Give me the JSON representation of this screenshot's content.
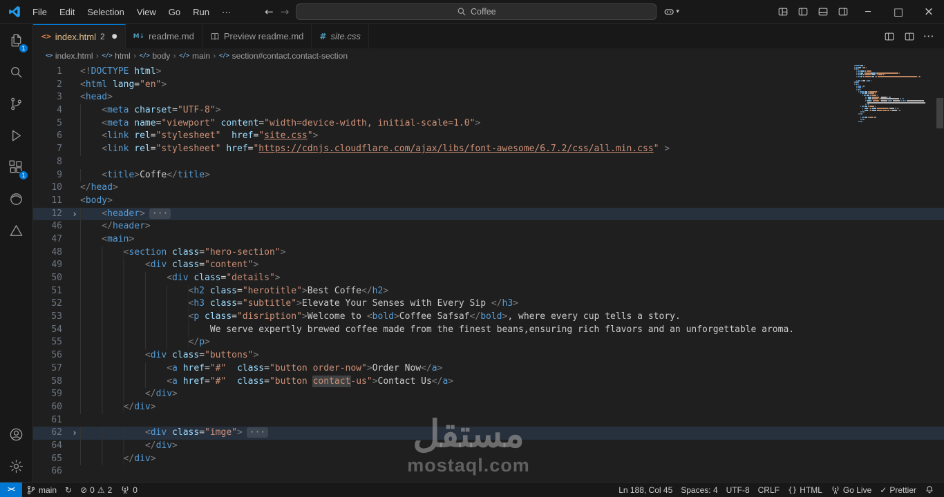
{
  "titlebar": {
    "menus": [
      "File",
      "Edit",
      "Selection",
      "View",
      "Go",
      "Run",
      "···"
    ],
    "search_text": "Coffee"
  },
  "icons": {
    "back": "←",
    "forward": "→",
    "chevron_down": "▾",
    "minimize": "─",
    "maximize": "□",
    "close": "×",
    "html_file": "<>",
    "markdown_file": "M↓",
    "css_file": "#",
    "element": "</>",
    "dirty": "●",
    "tab_more": "···",
    "fold": "›",
    "crumb_sep": "›",
    "remote": "><",
    "sync": "↻",
    "error": "⊘",
    "warning": "⚠",
    "check": "✓",
    "braces": "{}"
  },
  "activity_bar": {
    "explorer_badge": "1",
    "extensions_badge": "1"
  },
  "tabs": [
    {
      "label": "index.html",
      "badge": "2"
    },
    {
      "label": "readme.md"
    },
    {
      "label": "Preview readme.md"
    },
    {
      "label": "site.css"
    }
  ],
  "breadcrumb": [
    "index.html",
    "html",
    "body",
    "main",
    "section#contact.contact-section"
  ],
  "editor": {
    "lines": [
      {
        "n": 1,
        "i": 0,
        "t": [
          [
            "p",
            "<!"
          ],
          [
            "t",
            "DOCTYPE"
          ],
          [
            "a",
            " html"
          ],
          [
            "p",
            ">"
          ]
        ]
      },
      {
        "n": 2,
        "i": 0,
        "t": [
          [
            "p",
            "<"
          ],
          [
            "t",
            "html"
          ],
          [
            "a",
            " lang"
          ],
          [
            "o",
            "="
          ],
          [
            "s",
            "\"en\""
          ],
          [
            "p",
            ">"
          ]
        ]
      },
      {
        "n": 3,
        "i": 0,
        "t": [
          [
            "p",
            "<"
          ],
          [
            "t",
            "head"
          ],
          [
            "p",
            ">"
          ]
        ]
      },
      {
        "n": 4,
        "i": 4,
        "t": [
          [
            "p",
            "<"
          ],
          [
            "t",
            "meta"
          ],
          [
            "a",
            " charset"
          ],
          [
            "o",
            "="
          ],
          [
            "s",
            "\"UTF-8\""
          ],
          [
            "p",
            ">"
          ]
        ]
      },
      {
        "n": 5,
        "i": 4,
        "t": [
          [
            "p",
            "<"
          ],
          [
            "t",
            "meta"
          ],
          [
            "a",
            " name"
          ],
          [
            "o",
            "="
          ],
          [
            "s",
            "\"viewport\""
          ],
          [
            "a",
            " content"
          ],
          [
            "o",
            "="
          ],
          [
            "s",
            "\"width=device-width, initial-scale=1.0\""
          ],
          [
            "p",
            ">"
          ]
        ]
      },
      {
        "n": 6,
        "i": 4,
        "t": [
          [
            "p",
            "<"
          ],
          [
            "t",
            "link"
          ],
          [
            "a",
            " rel"
          ],
          [
            "o",
            "="
          ],
          [
            "s",
            "\"stylesheet\""
          ],
          [
            "a",
            "  href"
          ],
          [
            "o",
            "="
          ],
          [
            "s",
            "\""
          ],
          [
            "u",
            "site.css"
          ],
          [
            "s",
            "\""
          ],
          [
            "p",
            ">"
          ]
        ]
      },
      {
        "n": 7,
        "i": 4,
        "t": [
          [
            "p",
            "<"
          ],
          [
            "t",
            "link"
          ],
          [
            "a",
            " rel"
          ],
          [
            "o",
            "="
          ],
          [
            "s",
            "\"stylesheet\""
          ],
          [
            "a",
            " href"
          ],
          [
            "o",
            "="
          ],
          [
            "s",
            "\""
          ],
          [
            "u",
            "https://cdnjs.cloudflare.com/ajax/libs/font-awesome/6.7.2/css/all.min.css"
          ],
          [
            "s",
            "\""
          ],
          [
            "o",
            " "
          ],
          [
            "p",
            ">"
          ]
        ]
      },
      {
        "n": 8,
        "i": 0,
        "t": []
      },
      {
        "n": 9,
        "i": 4,
        "t": [
          [
            "p",
            "<"
          ],
          [
            "t",
            "title"
          ],
          [
            "p",
            ">"
          ],
          [
            "x",
            "Coffe"
          ],
          [
            "p",
            "</"
          ],
          [
            "t",
            "title"
          ],
          [
            "p",
            ">"
          ]
        ]
      },
      {
        "n": 10,
        "i": 0,
        "t": [
          [
            "p",
            "</"
          ],
          [
            "t",
            "head"
          ],
          [
            "p",
            ">"
          ]
        ]
      },
      {
        "n": 11,
        "i": 0,
        "t": [
          [
            "p",
            "<"
          ],
          [
            "t",
            "body"
          ],
          [
            "p",
            ">"
          ]
        ]
      },
      {
        "n": 12,
        "i": 4,
        "fold": true,
        "hl": true,
        "t": [
          [
            "p",
            "<"
          ],
          [
            "t",
            "header"
          ],
          [
            "p",
            ">"
          ],
          [
            "f",
            "···"
          ]
        ]
      },
      {
        "n": 46,
        "i": 4,
        "t": [
          [
            "p",
            "</"
          ],
          [
            "t",
            "header"
          ],
          [
            "p",
            ">"
          ]
        ]
      },
      {
        "n": 47,
        "i": 4,
        "t": [
          [
            "p",
            "<"
          ],
          [
            "t",
            "main"
          ],
          [
            "p",
            ">"
          ]
        ]
      },
      {
        "n": 48,
        "i": 8,
        "t": [
          [
            "p",
            "<"
          ],
          [
            "t",
            "section"
          ],
          [
            "a",
            " class"
          ],
          [
            "o",
            "="
          ],
          [
            "s",
            "\"hero-section\""
          ],
          [
            "p",
            ">"
          ]
        ]
      },
      {
        "n": 49,
        "i": 12,
        "t": [
          [
            "p",
            "<"
          ],
          [
            "t",
            "div"
          ],
          [
            "a",
            " class"
          ],
          [
            "o",
            "="
          ],
          [
            "s",
            "\"content\""
          ],
          [
            "p",
            ">"
          ]
        ]
      },
      {
        "n": 50,
        "i": 16,
        "t": [
          [
            "p",
            "<"
          ],
          [
            "t",
            "div"
          ],
          [
            "a",
            " class"
          ],
          [
            "o",
            "="
          ],
          [
            "s",
            "\"details\""
          ],
          [
            "p",
            ">"
          ]
        ]
      },
      {
        "n": 51,
        "i": 20,
        "t": [
          [
            "p",
            "<"
          ],
          [
            "t",
            "h2"
          ],
          [
            "a",
            " class"
          ],
          [
            "o",
            "="
          ],
          [
            "s",
            "\"herotitle\""
          ],
          [
            "p",
            ">"
          ],
          [
            "x",
            "Best Coffe"
          ],
          [
            "p",
            "</"
          ],
          [
            "t",
            "h2"
          ],
          [
            "p",
            ">"
          ]
        ]
      },
      {
        "n": 52,
        "i": 20,
        "t": [
          [
            "p",
            "<"
          ],
          [
            "t",
            "h3"
          ],
          [
            "a",
            " class"
          ],
          [
            "o",
            "="
          ],
          [
            "s",
            "\"subtitle\""
          ],
          [
            "p",
            ">"
          ],
          [
            "x",
            "Elevate Your Senses with Every Sip "
          ],
          [
            "p",
            "</"
          ],
          [
            "t",
            "h3"
          ],
          [
            "p",
            ">"
          ]
        ]
      },
      {
        "n": 53,
        "i": 20,
        "t": [
          [
            "p",
            "<"
          ],
          [
            "t",
            "p"
          ],
          [
            "a",
            " class"
          ],
          [
            "o",
            "="
          ],
          [
            "s",
            "\"disription\""
          ],
          [
            "p",
            ">"
          ],
          [
            "x",
            "Welcome to "
          ],
          [
            "p",
            "<"
          ],
          [
            "t",
            "bold"
          ],
          [
            "p",
            ">"
          ],
          [
            "x",
            "Coffee Safsaf"
          ],
          [
            "p",
            "</"
          ],
          [
            "t",
            "bold"
          ],
          [
            "p",
            ">"
          ],
          [
            "x",
            ", where every cup tells a story."
          ]
        ]
      },
      {
        "n": 54,
        "i": 24,
        "t": [
          [
            "x",
            "We serve expertly brewed coffee made from the finest beans,ensuring rich flavors and an unforgettable aroma."
          ]
        ]
      },
      {
        "n": 55,
        "i": 20,
        "t": [
          [
            "p",
            "</"
          ],
          [
            "t",
            "p"
          ],
          [
            "p",
            ">"
          ]
        ]
      },
      {
        "n": 56,
        "i": 12,
        "t": [
          [
            "p",
            "<"
          ],
          [
            "t",
            "div"
          ],
          [
            "a",
            " class"
          ],
          [
            "o",
            "="
          ],
          [
            "s",
            "\"buttons\""
          ],
          [
            "p",
            ">"
          ]
        ]
      },
      {
        "n": 57,
        "i": 16,
        "t": [
          [
            "p",
            "<"
          ],
          [
            "t",
            "a"
          ],
          [
            "a",
            " href"
          ],
          [
            "o",
            "="
          ],
          [
            "s",
            "\"#\""
          ],
          [
            "a",
            "  class"
          ],
          [
            "o",
            "="
          ],
          [
            "s",
            "\"button order-now\""
          ],
          [
            "p",
            ">"
          ],
          [
            "x",
            "Order Now"
          ],
          [
            "p",
            "</"
          ],
          [
            "t",
            "a"
          ],
          [
            "p",
            ">"
          ]
        ]
      },
      {
        "n": 58,
        "i": 16,
        "t": [
          [
            "p",
            "<"
          ],
          [
            "t",
            "a"
          ],
          [
            "a",
            " href"
          ],
          [
            "o",
            "="
          ],
          [
            "s",
            "\"#\""
          ],
          [
            "a",
            "  class"
          ],
          [
            "o",
            "="
          ],
          [
            "s",
            "\"button "
          ],
          [
            "m",
            "contact"
          ],
          [
            "s",
            "-us\""
          ],
          [
            "p",
            ">"
          ],
          [
            "x",
            "Contact Us"
          ],
          [
            "p",
            "</"
          ],
          [
            "t",
            "a"
          ],
          [
            "p",
            ">"
          ]
        ]
      },
      {
        "n": 59,
        "i": 12,
        "t": [
          [
            "p",
            "</"
          ],
          [
            "t",
            "div"
          ],
          [
            "p",
            ">"
          ]
        ]
      },
      {
        "n": 60,
        "i": 8,
        "t": [
          [
            "p",
            "</"
          ],
          [
            "t",
            "div"
          ],
          [
            "p",
            ">"
          ]
        ]
      },
      {
        "n": 61,
        "i": 0,
        "t": []
      },
      {
        "n": 62,
        "i": 12,
        "fold": true,
        "hl": true,
        "t": [
          [
            "p",
            "<"
          ],
          [
            "t",
            "div"
          ],
          [
            "a",
            " class"
          ],
          [
            "o",
            "="
          ],
          [
            "s",
            "\"imge\""
          ],
          [
            "p",
            ">"
          ],
          [
            "f",
            "···"
          ]
        ]
      },
      {
        "n": 64,
        "i": 12,
        "t": [
          [
            "p",
            "</"
          ],
          [
            "t",
            "div"
          ],
          [
            "p",
            ">"
          ]
        ]
      },
      {
        "n": 65,
        "i": 8,
        "t": [
          [
            "p",
            "</"
          ],
          [
            "t",
            "div"
          ],
          [
            "p",
            ">"
          ]
        ]
      },
      {
        "n": 66,
        "i": 0,
        "t": []
      }
    ]
  },
  "watermark": {
    "title": "مستقل",
    "subtitle": "mostaql.com"
  },
  "status_bar": {
    "branch": "main",
    "errors": "0",
    "warnings": "2",
    "ports": "0",
    "ln_col": "Ln 188, Col 45",
    "spaces": "Spaces: 4",
    "encoding": "UTF-8",
    "eol": "CRLF",
    "language": "HTML",
    "go_live": "Go Live",
    "prettier": "Prettier"
  }
}
